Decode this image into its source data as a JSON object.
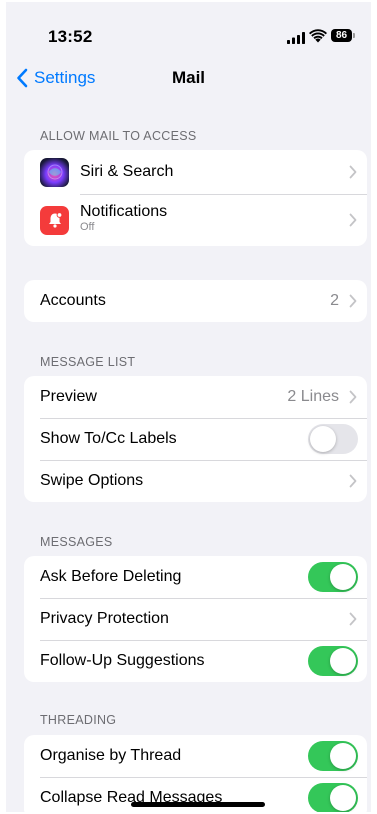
{
  "status_bar": {
    "time": "13:52",
    "battery": "86",
    "icons": [
      "signal-icon",
      "wifi-icon",
      "battery-icon"
    ]
  },
  "nav": {
    "back_label": "Settings",
    "title": "Mail"
  },
  "sections": {
    "allow_access": {
      "header": "ALLOW MAIL TO ACCESS",
      "siri_label": "Siri & Search",
      "notifications_label": "Notifications",
      "notifications_sublabel": "Off"
    },
    "accounts": {
      "label": "Accounts",
      "value": "2"
    },
    "message_list": {
      "header": "MESSAGE LIST",
      "preview_label": "Preview",
      "preview_value": "2 Lines",
      "show_tocc_label": "Show To/Cc Labels",
      "show_tocc_on": false,
      "swipe_label": "Swipe Options"
    },
    "messages": {
      "header": "MESSAGES",
      "ask_delete_label": "Ask Before Deleting",
      "ask_delete_on": true,
      "privacy_label": "Privacy Protection",
      "followup_label": "Follow-Up Suggestions",
      "followup_on": true
    },
    "threading": {
      "header": "THREADING",
      "organise_label": "Organise by Thread",
      "organise_on": true,
      "collapse_label": "Collapse Read Messages",
      "collapse_on": true
    }
  },
  "colors": {
    "accent": "#007aff",
    "toggle_on": "#34c759",
    "background": "#f2f2f7",
    "notifications_icon": "#f43b3b"
  }
}
